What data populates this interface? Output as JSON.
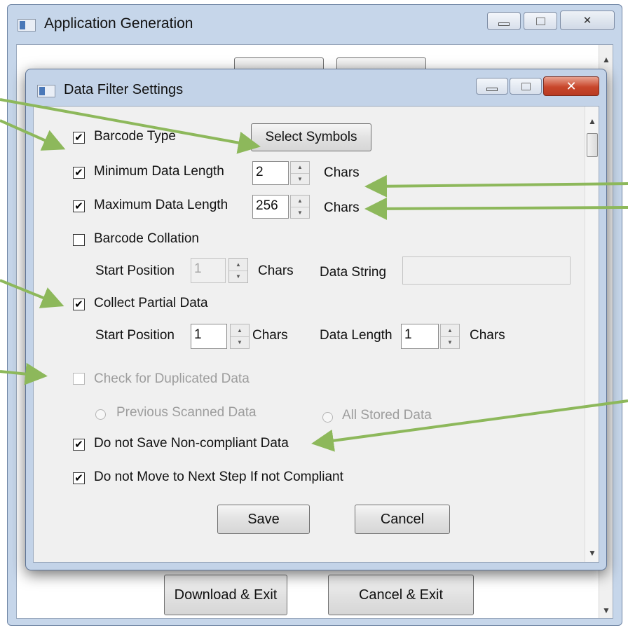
{
  "outer_window": {
    "title": "Application Generation",
    "caption_buttons": {
      "minimize": "minimize",
      "maximize": "maximize",
      "close": "✕"
    },
    "buttons": {
      "download_exit": "Download & Exit",
      "cancel_exit": "Cancel & Exit"
    }
  },
  "dialog": {
    "title": "Data Filter Settings",
    "caption_buttons": {
      "close": "✕"
    },
    "barcode_type": {
      "label": "Barcode Type",
      "checked": true
    },
    "select_symbols_button": "Select Symbols",
    "min_length": {
      "label": "Minimum Data Length",
      "value": "2",
      "unit": "Chars",
      "checked": true
    },
    "max_length": {
      "label": "Maximum Data Length",
      "value": "256",
      "unit": "Chars",
      "checked": true
    },
    "collation": {
      "label": "Barcode Collation",
      "checked": false,
      "start_label": "Start Position",
      "start_value": "1",
      "start_unit": "Chars",
      "data_string_label": "Data String",
      "data_string_value": ""
    },
    "partial": {
      "label": "Collect Partial Data",
      "checked": true,
      "start_label": "Start Position",
      "start_value": "1",
      "start_unit": "Chars",
      "length_label": "Data Length",
      "length_value": "1",
      "length_unit": "Chars"
    },
    "duplicate": {
      "label": "Check for Duplicated Data",
      "checked": false,
      "option_previous": "Previous Scanned Data",
      "option_all": "All Stored Data"
    },
    "no_save": {
      "label": "Do not Save Non-compliant Data",
      "checked": true
    },
    "no_move": {
      "label": "Do not Move to Next Step If not Compliant",
      "checked": true
    },
    "save_button": "Save",
    "cancel_button": "Cancel",
    "check_mark": "✔"
  },
  "annotation_color": "#8db85b",
  "icons": {
    "window_icon": "app-window-icon",
    "scroll_up": "▲",
    "scroll_down": "▼",
    "spin_up": "▲",
    "spin_down": "▼"
  }
}
